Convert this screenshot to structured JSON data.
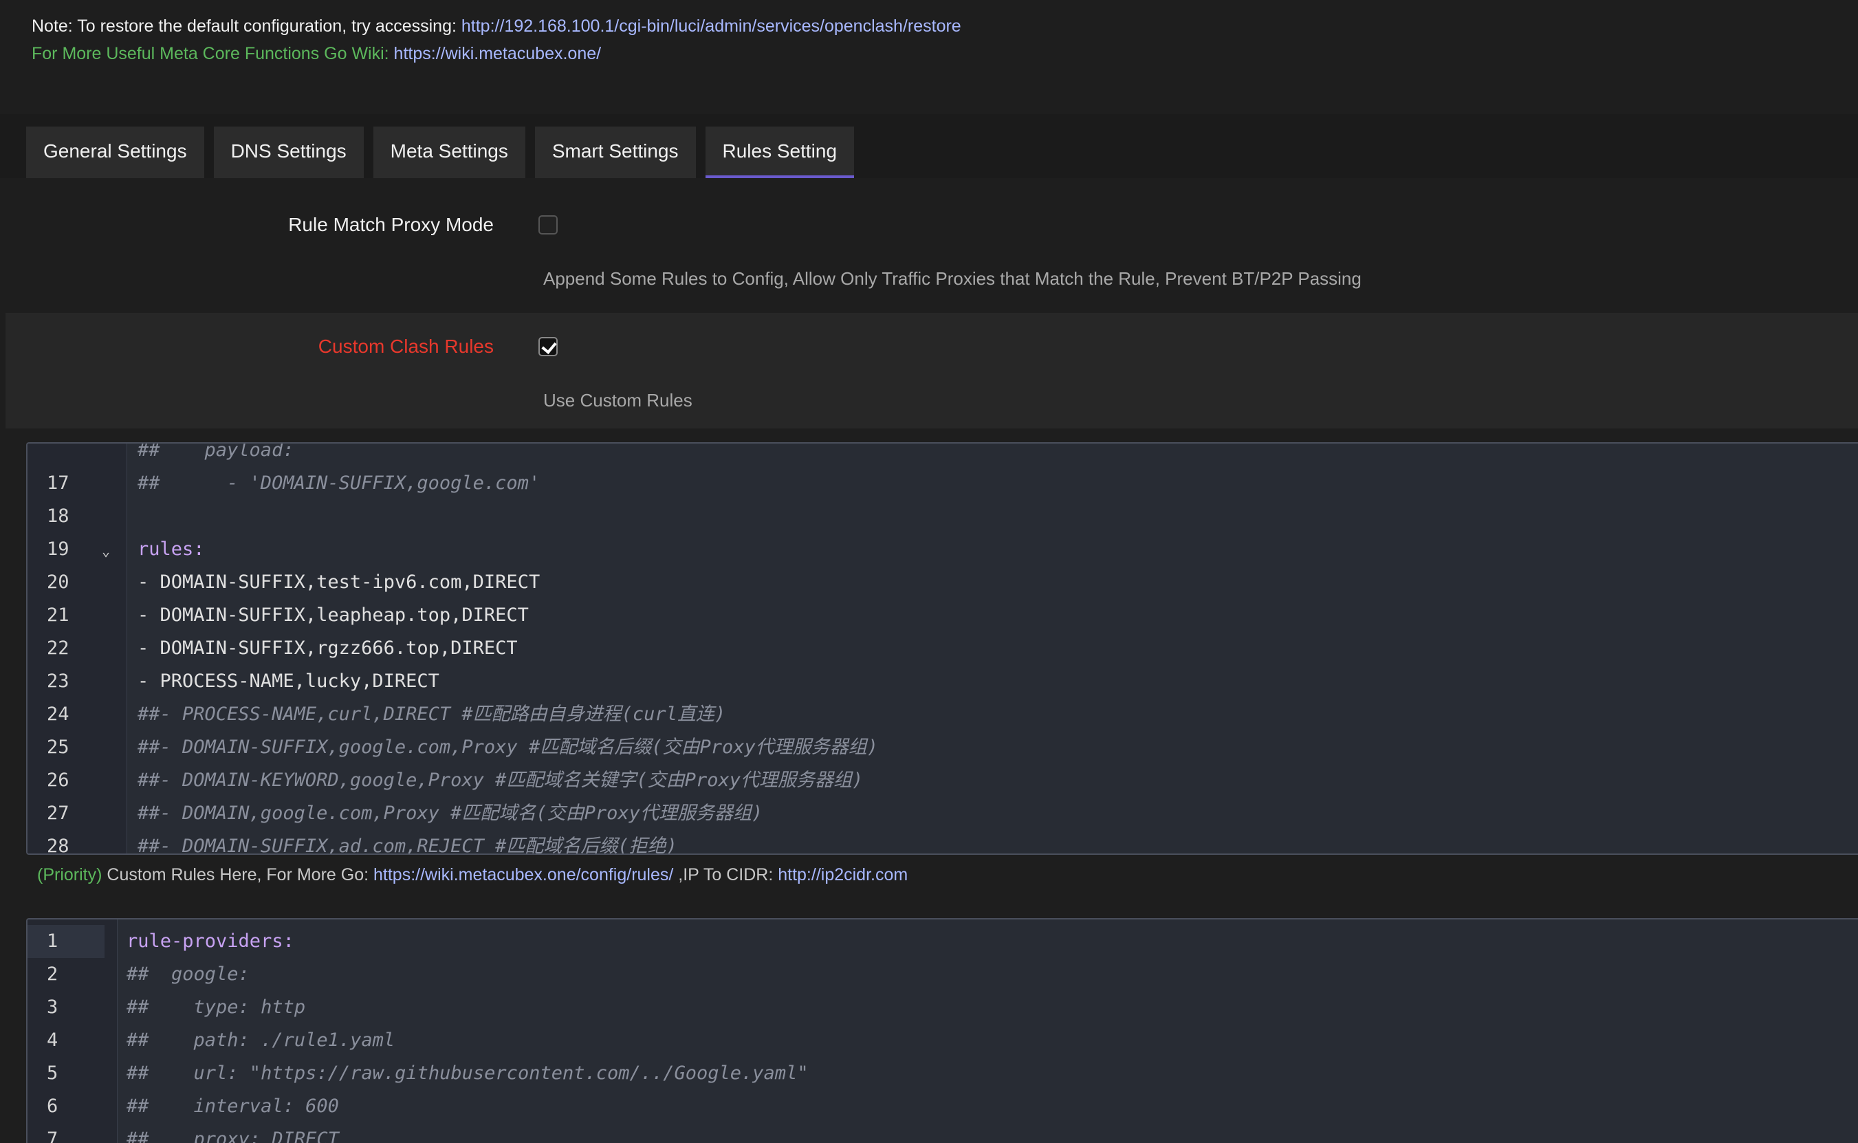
{
  "notes": {
    "restore_prefix": "Note: To restore the default configuration, try accessing: ",
    "restore_url": "http://192.168.100.1/cgi-bin/luci/admin/services/openclash/restore",
    "wiki_prefix": "For More Useful Meta Core Functions Go Wiki: ",
    "wiki_url": "https://wiki.metacubex.one/"
  },
  "tabs": [
    {
      "label": "General Settings"
    },
    {
      "label": "DNS Settings"
    },
    {
      "label": "Meta Settings"
    },
    {
      "label": "Smart Settings"
    },
    {
      "label": "Rules Setting"
    }
  ],
  "rule_match_proxy_mode": {
    "label": "Rule Match Proxy Mode",
    "checked": false,
    "description": "Append Some Rules to Config, Allow Only Traffic Proxies that Match the Rule, Prevent BT/P2P Passing"
  },
  "custom_clash_rules": {
    "label": "Custom Clash Rules",
    "checked": true,
    "description": "Use Custom Rules"
  },
  "rules_editor": {
    "lines": [
      {
        "num": "",
        "text": "##    payload:",
        "kind": "comment"
      },
      {
        "num": "17",
        "text": "##      - 'DOMAIN-SUFFIX,google.com'",
        "kind": "comment"
      },
      {
        "num": "18",
        "text": "",
        "kind": "plain"
      },
      {
        "num": "19",
        "text": "rules:",
        "kind": "key",
        "fold": "⌄"
      },
      {
        "num": "20",
        "text": "- DOMAIN-SUFFIX,test-ipv6.com,DIRECT",
        "kind": "plain"
      },
      {
        "num": "21",
        "text": "- DOMAIN-SUFFIX,leapheap.top,DIRECT",
        "kind": "plain"
      },
      {
        "num": "22",
        "text": "- DOMAIN-SUFFIX,rgzz666.top,DIRECT",
        "kind": "plain"
      },
      {
        "num": "23",
        "text": "- PROCESS-NAME,lucky,DIRECT",
        "kind": "plain"
      },
      {
        "num": "24",
        "text": "##- PROCESS-NAME,curl,DIRECT #匹配路由自身进程(curl直连)",
        "kind": "comment"
      },
      {
        "num": "25",
        "text": "##- DOMAIN-SUFFIX,google.com,Proxy #匹配域名后缀(交由Proxy代理服务器组)",
        "kind": "comment"
      },
      {
        "num": "26",
        "text": "##- DOMAIN-KEYWORD,google,Proxy #匹配域名关键字(交由Proxy代理服务器组)",
        "kind": "comment"
      },
      {
        "num": "27",
        "text": "##- DOMAIN,google.com,Proxy #匹配域名(交由Proxy代理服务器组)",
        "kind": "comment"
      },
      {
        "num": "28",
        "text": "##- DOMAIN-SUFFIX,ad.com,REJECT #匹配域名后缀(拒绝)",
        "kind": "comment"
      }
    ]
  },
  "hint": {
    "priority": "(Priority)",
    "text1": " Custom Rules Here, For More Go: ",
    "link1": "https://wiki.metacubex.one/config/rules/",
    "text2": " ,IP To CIDR: ",
    "link2": "http://ip2cidr.com"
  },
  "providers_editor": {
    "lines": [
      {
        "num": "1",
        "text": "rule-providers:",
        "kind": "key"
      },
      {
        "num": "2",
        "text": "##  google:",
        "kind": "comment"
      },
      {
        "num": "3",
        "text": "##    type: http",
        "kind": "comment"
      },
      {
        "num": "4",
        "text": "##    path: ./rule1.yaml",
        "kind": "comment"
      },
      {
        "num": "5",
        "text": "##    url: \"https://raw.githubusercontent.com/../Google.yaml\"",
        "kind": "comment"
      },
      {
        "num": "6",
        "text": "##    interval: 600",
        "kind": "comment"
      },
      {
        "num": "7",
        "text": "##    proxy: DIRECT",
        "kind": "comment"
      }
    ]
  }
}
